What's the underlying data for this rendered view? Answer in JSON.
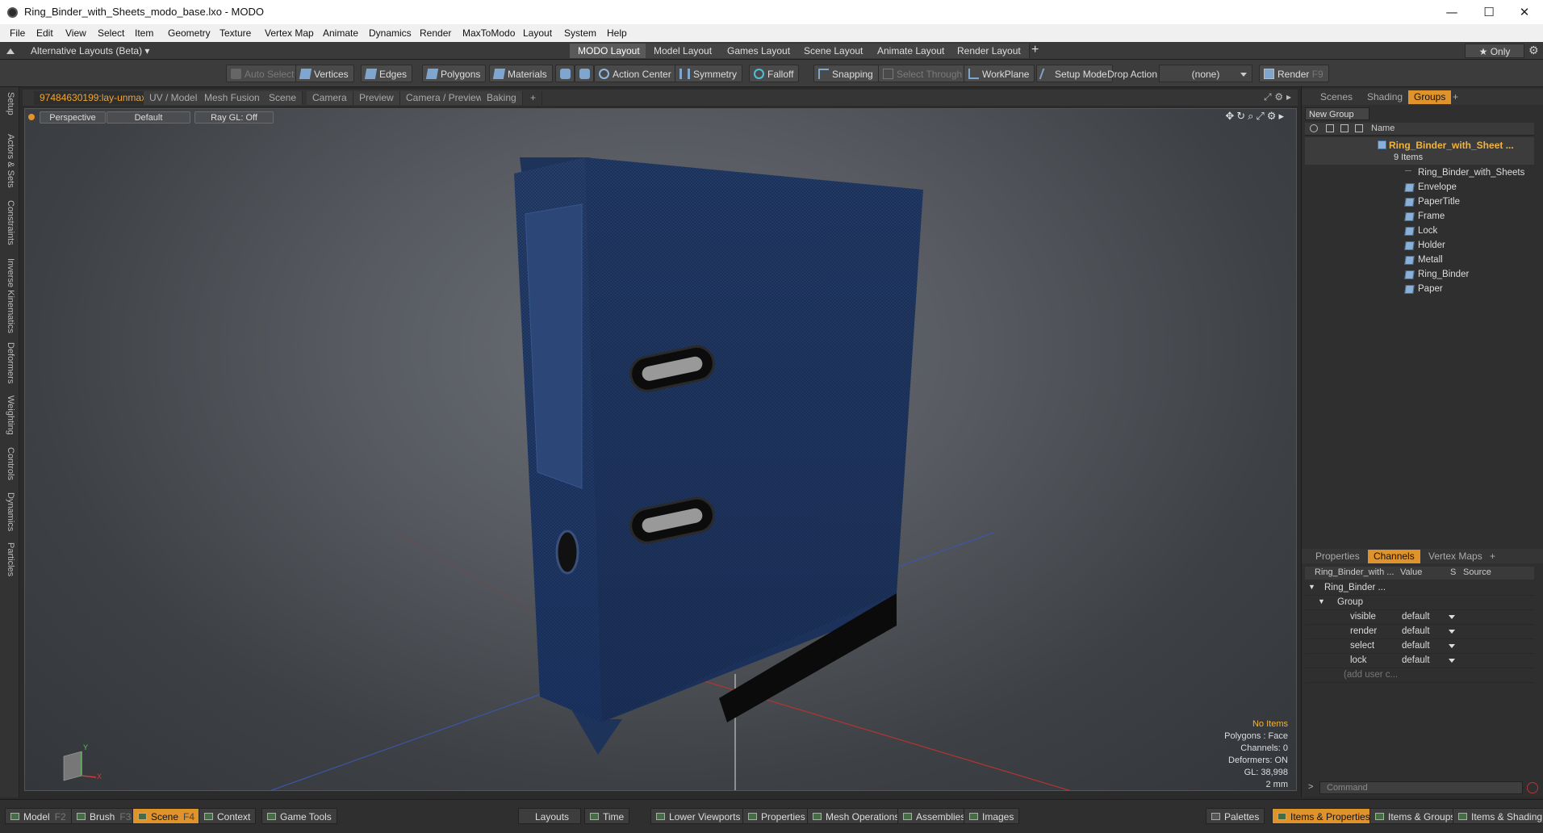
{
  "window": {
    "title": "Ring_Binder_with_Sheets_modo_base.lxo - MODO",
    "controls": [
      "—",
      "☐",
      "✕"
    ]
  },
  "menu": [
    "File",
    "Edit",
    "View",
    "Select",
    "Item",
    "Geometry",
    "Texture",
    "Vertex Map",
    "Animate",
    "Dynamics",
    "Render",
    "MaxToModo",
    "Layout",
    "System",
    "Help"
  ],
  "layout_bar": {
    "alt_layouts": "Alternative Layouts (Beta) ▾",
    "tabs": [
      "MODO Layout",
      "Model Layout",
      "Games Layout",
      "Scene Layout",
      "Animate Layout",
      "Render Layout"
    ],
    "add": "+",
    "only": "★ Only"
  },
  "toolbar": {
    "auto_select": "Auto Select",
    "vertices": "Vertices",
    "edges": "Edges",
    "polygons": "Polygons",
    "materials": "Materials",
    "action_center": "Action Center",
    "symmetry": "Symmetry",
    "falloff": "Falloff",
    "snapping": "Snapping",
    "select_through": "Select Through",
    "workplane": "WorkPlane",
    "setup_mode": "Setup Mode",
    "drop_action_label": "Drop Action",
    "drop_action_value": "(none)",
    "render": "Render",
    "render_key": "F9"
  },
  "viewport_tabs": [
    "97484630199:lay-unmax",
    "UV / Model",
    "Mesh Fusion",
    "Scene",
    "Camera",
    "Preview",
    "Camera / Preview",
    "Baking",
    "+"
  ],
  "left_tabs": [
    "Setup",
    "Actors & Sets",
    "Constraints",
    "Inverse Kinematics",
    "Deformers",
    "Weighting",
    "Controls",
    "Dynamics",
    "Particles"
  ],
  "viewport": {
    "view": "Perspective",
    "shading": "Default",
    "raygl": "Ray GL: Off",
    "info": {
      "items": "No Items",
      "polygons": "Polygons : Face",
      "channels": "Channels: 0",
      "deformers": "Deformers: ON",
      "gl": "GL: 38,998",
      "scale": "2 mm"
    },
    "axis": {
      "y": "Y",
      "x": "X"
    }
  },
  "right_panel": {
    "tabs": [
      "Scenes",
      "Shading",
      "Groups",
      "+"
    ],
    "new_group": "New Group",
    "name_header": "Name",
    "group": {
      "name": "Ring_Binder_with_Sheet ...",
      "count": "9 Items"
    },
    "items": [
      "Ring_Binder_with_Sheets",
      "Envelope",
      "PaperTitle",
      "Frame",
      "Lock",
      "Holder",
      "Metall",
      "Ring_Binder",
      "Paper"
    ],
    "lower_tabs": [
      "Properties",
      "Channels",
      "Vertex Maps",
      "+"
    ],
    "channels_header": {
      "name": "Ring_Binder_with ...",
      "value": "Value",
      "s": "S",
      "source": "Source"
    },
    "tree": {
      "root": "Ring_Binder ...",
      "group": "Group"
    },
    "channels": [
      {
        "name": "visible",
        "value": "default"
      },
      {
        "name": "render",
        "value": "default"
      },
      {
        "name": "select",
        "value": "default"
      },
      {
        "name": "lock",
        "value": "default"
      }
    ],
    "add_user": "(add user c...",
    "command_placeholder": "Command"
  },
  "bottom_bar": {
    "left": [
      {
        "label": "Model",
        "key": "F2"
      },
      {
        "label": "Brush",
        "key": "F3"
      },
      {
        "label": "Scene",
        "key": "F4"
      },
      {
        "label": "Context",
        "key": ""
      },
      {
        "label": "Game Tools",
        "key": ""
      }
    ],
    "middle": [
      "Layouts",
      "Time",
      "Lower Viewports",
      "Properties",
      "Mesh Operations",
      "Assemblies",
      "Images"
    ],
    "right": [
      "Palettes",
      "Items & Properties",
      "Items & Groups",
      "Items & Shading"
    ]
  },
  "colors": {
    "accent": "#e0932a",
    "binder": "#1f3358",
    "grid_x": "#b03030",
    "grid_z": "#3a4f9a"
  }
}
